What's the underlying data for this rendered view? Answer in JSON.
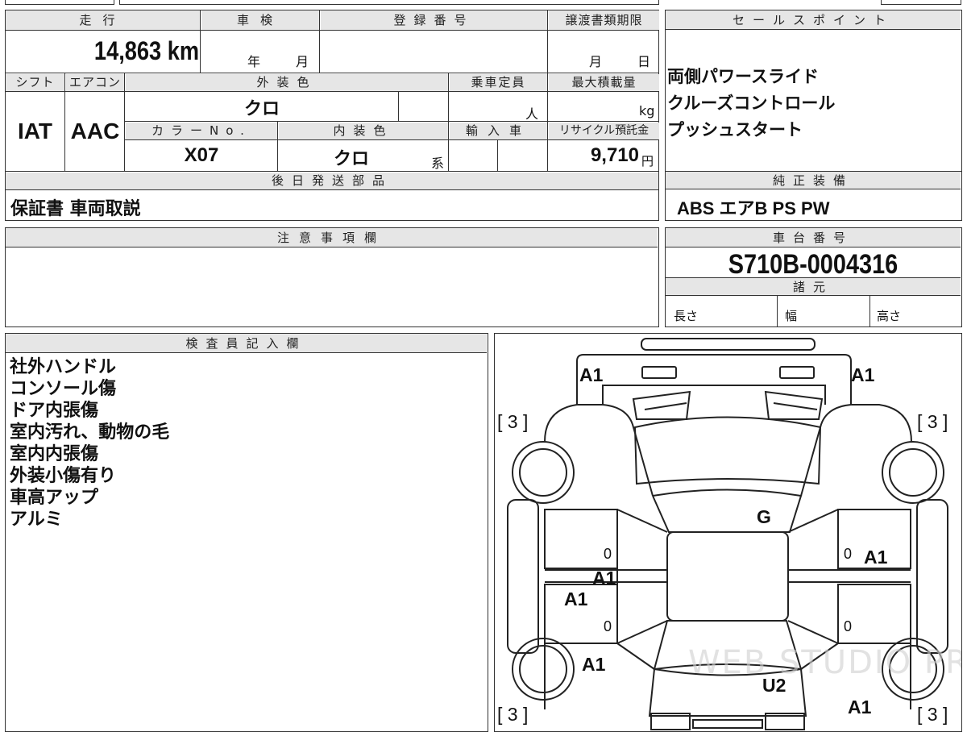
{
  "vehicle": {
    "mileage_label": "走行",
    "mileage": "14,863 km",
    "shaken_label": "車検",
    "shaken_year": "年",
    "shaken_month": "月",
    "reg_label": "登録番号",
    "transfer_label": "譲渡書類期限",
    "transfer_month": "月",
    "transfer_day": "日",
    "shift_label": "シフト",
    "shift": "IAT",
    "ac_label": "エアコン",
    "ac": "AAC",
    "ext_color_label": "外装色",
    "ext_color": "クロ",
    "capacity_label": "乗車定員",
    "capacity_unit": "人",
    "max_load_label": "最大積載量",
    "max_load_unit": "kg",
    "color_no_label": "カラーNo.",
    "color_no": "X07",
    "int_color_label": "内装色",
    "int_color": "クロ",
    "int_color_suffix": "系",
    "import_label": "輸入車",
    "recycle_label": "リサイクル預託金",
    "recycle_fee": "9,710",
    "recycle_unit": "円",
    "later_parts_label": "後日発送部品",
    "later_parts": "保証書 車両取説"
  },
  "sales": {
    "label": "セールスポイント",
    "points": [
      "両側パワースライド",
      "クルーズコントロール",
      "プッシュスタート"
    ]
  },
  "equipment": {
    "label": "純正装備",
    "items": "ABS エアB PS PW"
  },
  "notes": {
    "label": "注意事項欄"
  },
  "chassis": {
    "label": "車台番号",
    "number": "S710B-0004316",
    "spec_label": "諸元",
    "length_label": "長さ",
    "width_label": "幅",
    "height_label": "高さ"
  },
  "inspector": {
    "label": "検査員記入欄",
    "notes": [
      "社外ハンドル",
      "コンソール傷",
      "ドア内張傷",
      "室内汚れ、動物の毛",
      "室内内張傷",
      "外装小傷有り",
      "車高アップ",
      "アルミ"
    ]
  },
  "diagram": {
    "marks": {
      "front_left": "A1",
      "front_right": "A1",
      "tire_fl": "[ 3 ]",
      "tire_fr": "[ 3 ]",
      "tire_rl": "[ 3 ]",
      "tire_rr": "[ 3 ]",
      "windshield": "G",
      "left_door_a": "A1",
      "left_door_b": "A1",
      "right_door": "A1",
      "left_rear": "A1",
      "rear_glass": "U2",
      "rear_right": "A1",
      "zero": "0"
    },
    "watermark": "WEB STUDIO PRO"
  }
}
